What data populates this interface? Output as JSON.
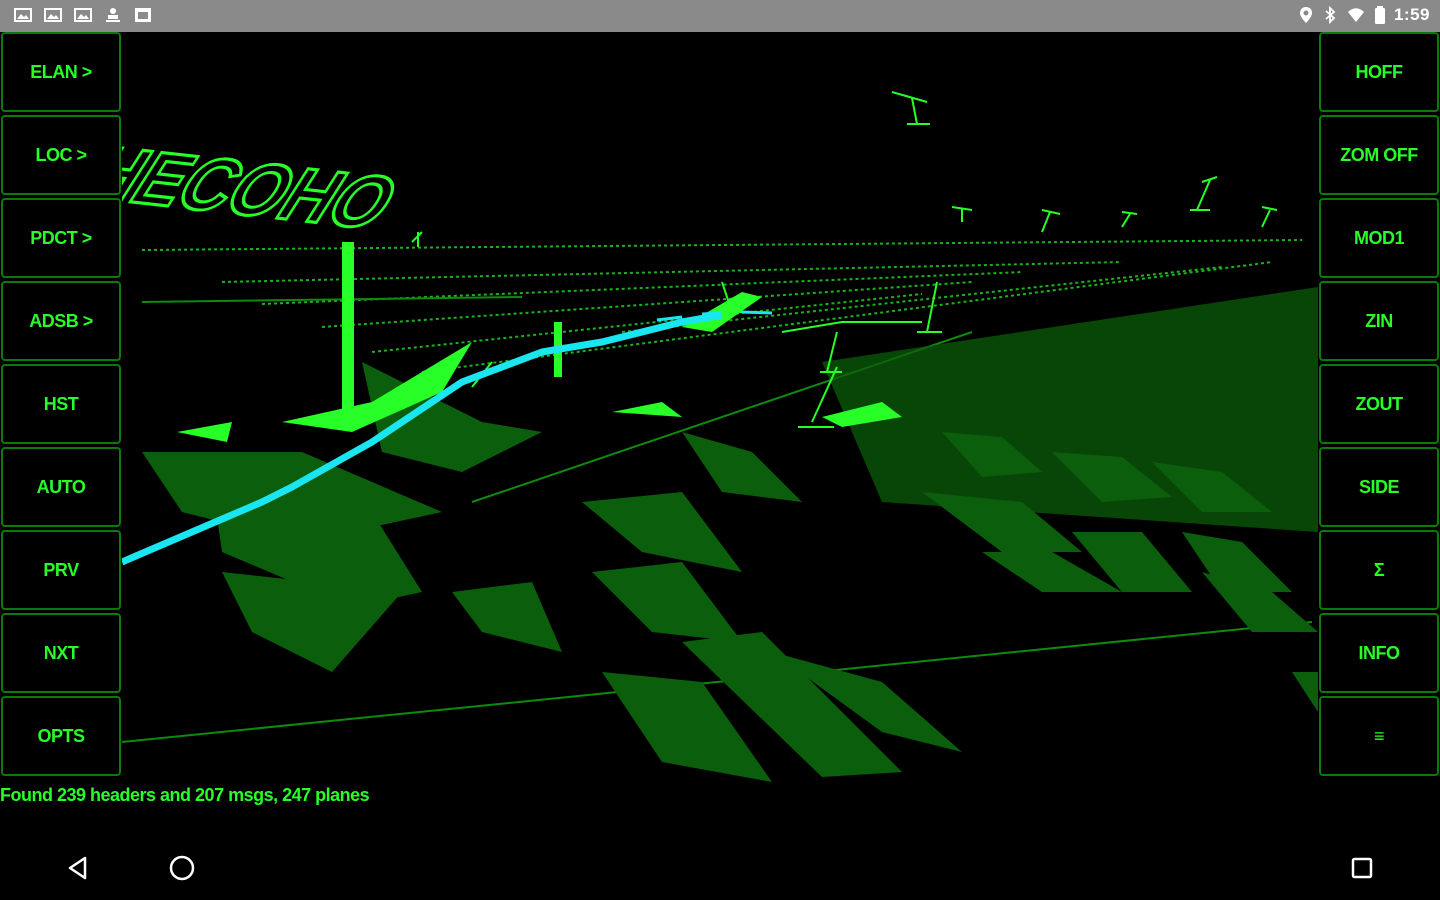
{
  "status_bar": {
    "time": "1:59",
    "notification_icons": [
      "image-icon",
      "image-icon",
      "image-icon",
      "download-icon",
      "gallery-icon"
    ],
    "system_icons": [
      "location-icon",
      "bluetooth-icon",
      "wifi-icon",
      "battery-icon"
    ]
  },
  "left_buttons": [
    "ELAN >",
    "LOC >",
    "PDCT >",
    "ADSB >",
    "HST",
    "AUTO",
    "PRV",
    "NXT",
    "OPTS"
  ],
  "right_buttons": [
    "HOFF",
    "ZOM OFF",
    "MOD1",
    "ZIN",
    "ZOUT",
    "SIDE",
    "Σ",
    "INFO",
    "≡"
  ],
  "scene": {
    "label_text": "ZHECOHO",
    "track_color": "#19e6f0",
    "terrain_color": "#0b5e0b",
    "marker_color": "#28ff28"
  },
  "message": "Found 239 headers and 207 msgs, 247 planes",
  "nav": {
    "icons": [
      "back-icon",
      "home-icon",
      "recents-icon"
    ]
  }
}
